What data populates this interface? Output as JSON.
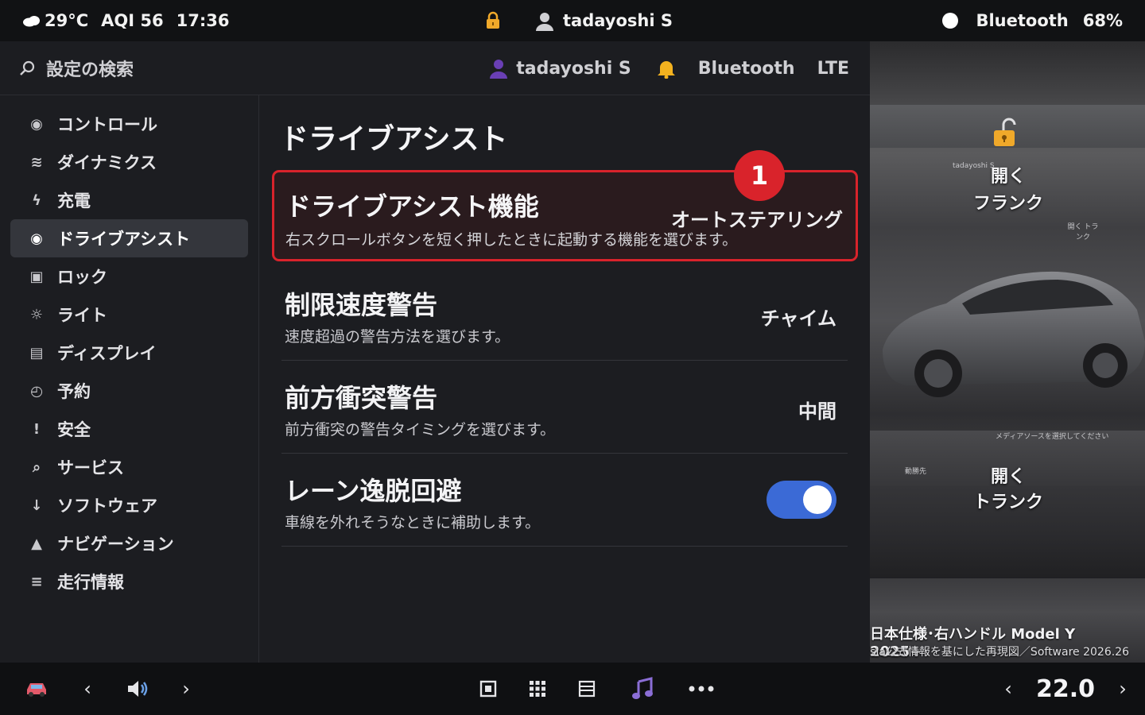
{
  "status_bar": {
    "temperature": "29°C",
    "aqi": "AQI 56",
    "time": "17:36",
    "user": "tadayoshi S",
    "bluetooth": "Bluetooth",
    "battery": "68%"
  },
  "header": {
    "search_placeholder": "設定の検索",
    "user": "tadayoshi S",
    "bluetooth": "Bluetooth",
    "network": "LTE"
  },
  "sidebar": {
    "items": [
      {
        "label": "コントロール",
        "icon": "control-icon",
        "glyph": "◉"
      },
      {
        "label": "ダイナミクス",
        "icon": "dynamics-icon",
        "glyph": "≋"
      },
      {
        "label": "充電",
        "icon": "charging-icon",
        "glyph": "ϟ"
      },
      {
        "label": "ドライブアシスト",
        "icon": "drive-assist-icon",
        "glyph": "◉"
      },
      {
        "label": "ロック",
        "icon": "lock-icon",
        "glyph": "▣"
      },
      {
        "label": "ライト",
        "icon": "light-icon",
        "glyph": "☼"
      },
      {
        "label": "ディスプレイ",
        "icon": "display-icon",
        "glyph": "▤"
      },
      {
        "label": "予約",
        "icon": "schedule-icon",
        "glyph": "◴"
      },
      {
        "label": "安全",
        "icon": "safety-icon",
        "glyph": "!"
      },
      {
        "label": "サービス",
        "icon": "service-icon",
        "glyph": "⌕"
      },
      {
        "label": "ソフトウェア",
        "icon": "software-icon",
        "glyph": "↓"
      },
      {
        "label": "ナビゲーション",
        "icon": "navigation-icon",
        "glyph": "▲"
      },
      {
        "label": "走行情報",
        "icon": "trips-icon",
        "glyph": "≡"
      }
    ],
    "active_index": 3
  },
  "content": {
    "title": "ドライブアシスト",
    "rows": [
      {
        "title": "ドライブアシスト機能",
        "desc": "右スクロールボタンを短く押したときに起動する機能を選びます。",
        "value": "オートステアリング",
        "badge": "1"
      },
      {
        "title": "制限速度警告",
        "desc": "速度超過の警告方法を選びます。",
        "value": "チャイム"
      },
      {
        "title": "前方衝突警告",
        "desc": "前方衝突の警告タイミングを選びます。",
        "value": "中間"
      },
      {
        "title": "レーン逸脱回避",
        "desc": "車線を外れそうなときに補助します。",
        "toggle_on": true
      }
    ]
  },
  "photo": {
    "frunk_open": "開く",
    "frunk_label": "フランク",
    "trunk_open": "開く",
    "trunk_label": "トランク",
    "small_user": "tadayoshi S",
    "small_frunk": "開く\nトランク",
    "media_prompt": "メディアソースを選択してください",
    "small_favorite": "動勝先",
    "caption_1": "日本仕様･右ハンドル Model Y 2025+",
    "caption_2": "EVNOVA実車画面＋Tesla公式情報を基にした再現図／Software 2026.26"
  },
  "dock": {
    "temperature": "22.0",
    "left_arrow": "‹",
    "right_arrow": "›"
  },
  "colors": {
    "highlight": "#d9232b",
    "toggle": "#3b6ad6",
    "active_item_bg": "#34363c"
  }
}
